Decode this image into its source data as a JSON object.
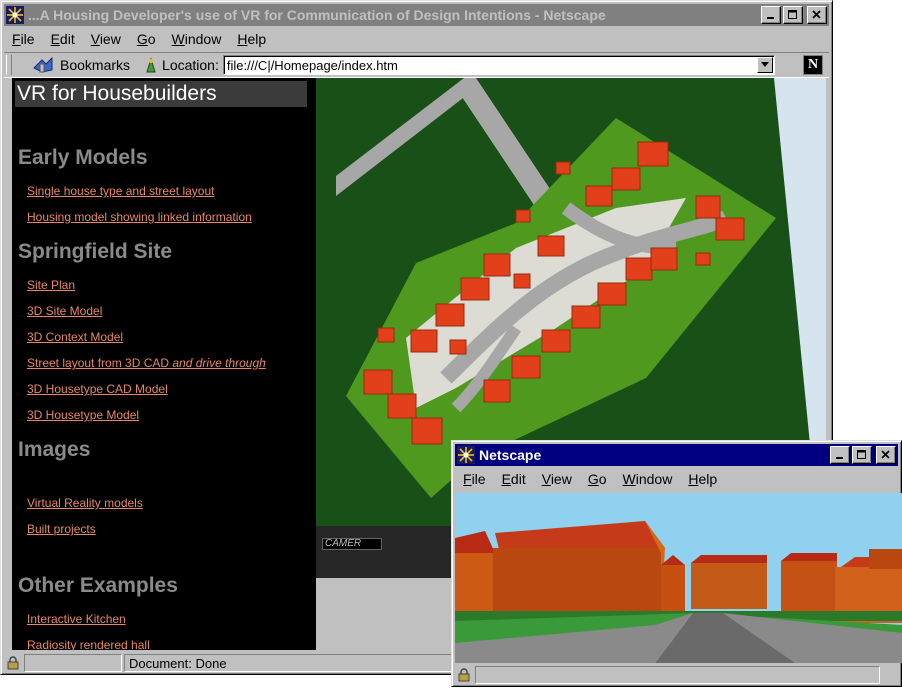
{
  "main_window": {
    "title": "...A Housing Developer's use of VR for Communication of Design Intentions - Netscape",
    "menu": [
      "File",
      "Edit",
      "View",
      "Go",
      "Window",
      "Help"
    ],
    "bookmarks_label": "Bookmarks",
    "location_label": "Location:",
    "location_value": "file:///C|/Homepage/index.htm",
    "status": "Document: Done"
  },
  "sidebar": {
    "title": "VR for Housebuilders",
    "sections": [
      {
        "heading": "Early Models",
        "links": [
          "Single house type and street layout",
          "Housing model showing linked information"
        ]
      },
      {
        "heading": "Springfield Site",
        "links": [
          "Site Plan",
          "3D Site Model",
          "3D Context Model",
          "Street layout from 3D CAD",
          "3D Housetype CAD Model",
          "3D Housetype Model"
        ]
      },
      {
        "heading": "Images",
        "links": [
          "Virtual Reality models",
          "Built projects"
        ]
      },
      {
        "heading": "Other Examples",
        "links": [
          "Interactive Kitchen",
          "Radiosity rendered hall"
        ]
      }
    ],
    "street_link_suffix": "and drive through"
  },
  "vr_viewer": {
    "camera_label": "CAMER"
  },
  "popup_window": {
    "title": "Netscape",
    "menu": [
      "File",
      "Edit",
      "View",
      "Go",
      "Window",
      "Help"
    ]
  },
  "colors": {
    "title_inactive": "#808080",
    "title_active": "#000080",
    "link": "#e8866a",
    "heading": "#8a8a8a",
    "grass_dark": "#185017",
    "grass_light": "#4f9a1e",
    "roof": "#e2401a"
  },
  "icons": [
    "netscape-app-icon",
    "bookmarks-icon",
    "location-icon",
    "dropdown-arrow-icon",
    "netscape-n-logo",
    "minimize-icon",
    "maximize-icon",
    "close-icon",
    "security-lock-icon"
  ]
}
